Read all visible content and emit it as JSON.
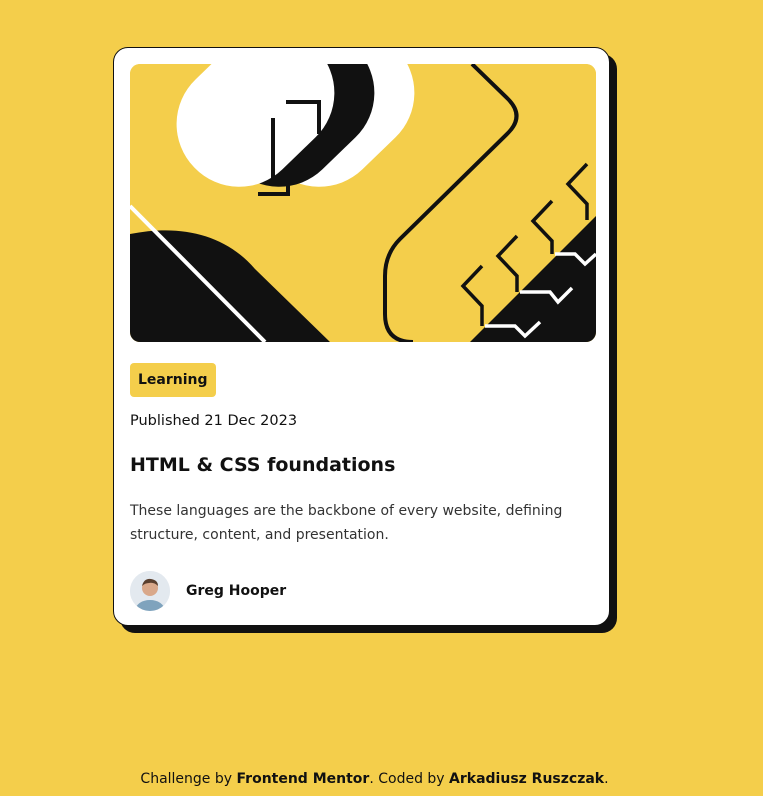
{
  "card": {
    "tag": "Learning",
    "published": "Published 21 Dec 2023",
    "title": "HTML & CSS foundations",
    "description": "These languages are the backbone of every website, defining structure, content, and presentation.",
    "author": {
      "name": "Greg Hooper",
      "avatar_icon": "author-avatar"
    },
    "illustration_icon": "blog-illustration"
  },
  "footer": {
    "prefix": "Challenge by ",
    "brand": "Frontend Mentor",
    "middle": ". Coded by ",
    "coder": "Arkadiusz Ruszczak",
    "suffix": "."
  },
  "colors": {
    "background": "#f4ce4b",
    "card": "#ffffff",
    "ink": "#111111",
    "tag_bg": "#f4ce4b"
  }
}
